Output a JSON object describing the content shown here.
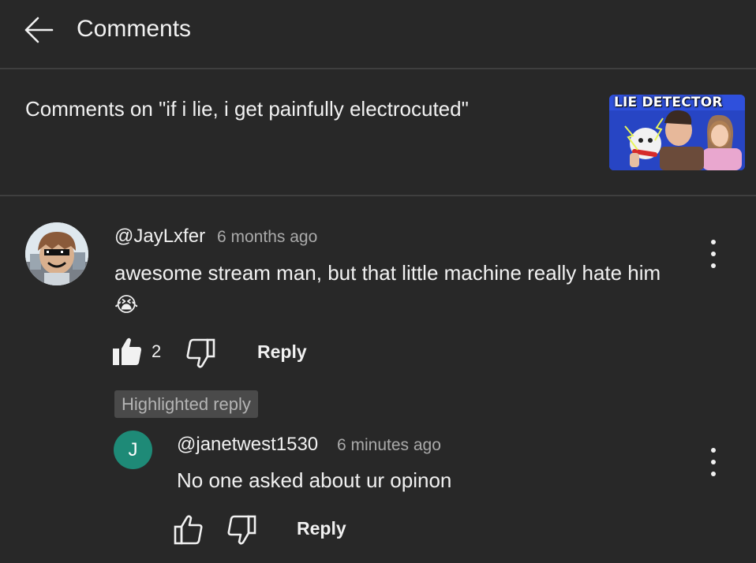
{
  "header": {
    "title": "Comments",
    "back_icon": "arrow-left-icon"
  },
  "video": {
    "context_label": "Comments on \"if i lie, i get painfully electrocuted\"",
    "thumbnail_text": "LIE DETECTOR"
  },
  "comment": {
    "author": "@JayLxfer",
    "time": "6 months ago",
    "text": "awesome stream man, but that little machine really hate him 😭",
    "like_count": "2",
    "reply_label": "Reply",
    "liked": true
  },
  "highlight_badge": "Highlighted reply",
  "reply": {
    "avatar_letter": "J",
    "avatar_color": "#1e8a77",
    "author": "@janetwest1530",
    "time": "6 minutes ago",
    "text": "No one asked about ur opinon",
    "reply_label": "Reply"
  },
  "colors": {
    "background": "#282828",
    "divider": "#3f3f3f",
    "secondary_text": "#aaaaaa"
  }
}
